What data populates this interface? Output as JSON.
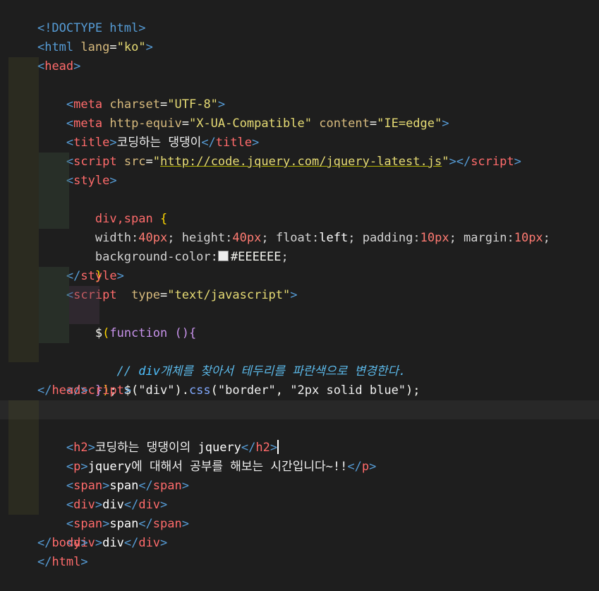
{
  "editor": {
    "lines": {
      "l1": "<!DOCTYPE html>",
      "l2_tag": "html",
      "l2_attr": "lang",
      "l2_val": "\"ko\"",
      "l3_tag": "head",
      "l4_tag": "meta",
      "l4_attr": "charset",
      "l4_val": "\"UTF-8\"",
      "l5_tag": "meta",
      "l5_attr1": "http-equiv",
      "l5_val1": "\"X-UA-Compatible\"",
      "l5_attr2": "content",
      "l5_val2": "\"IE=edge\"",
      "l6_tag": "title",
      "l6_text": "코딩하는 댕댕이",
      "l7_tag": "script",
      "l7_attr": "src",
      "l7_url": "http://code.jquery.com/jquery-latest.js",
      "l8_tag": "style",
      "l9_sel": "div,span",
      "l10_width": "width",
      "l10_width_v": "40px",
      "l10_height": "height",
      "l10_height_v": "40px",
      "l10_float": "float",
      "l10_float_v": "left",
      "l10_padding": "padding",
      "l10_padding_v": "10px",
      "l10_margin": "margin",
      "l10_margin_v": "10px",
      "l11_prop": "background-color",
      "l11_val": "#EEEEEE",
      "l13_tag": "style",
      "l14_tag": "script",
      "l14_attr": "type",
      "l14_val": "\"text/javascript\"",
      "l15_fn": "function",
      "l16_comment_kw": "div",
      "l16_comment": "개체를 찾아서 테두리를 파란색으로 변경한다.",
      "l17_sel": "\"div\"",
      "l17_method": "css",
      "l17_arg1": "\"border\"",
      "l17_arg2": "\"2px solid blue\"",
      "l19_tag": "script",
      "l20_tag": "head",
      "l21_tag": "body",
      "l22_tag": "h2",
      "l22_text": "코딩하는 댕댕이의 ",
      "l22_bold": "jquery",
      "l23_tag": "p",
      "l23_bold": "jquery",
      "l23_text": "에 대해서 공부를 해보는 시간입니다~!!",
      "l24_tag": "span",
      "l24_text": "span",
      "l25_tag": "div",
      "l25_text": "div",
      "l26_tag": "span",
      "l26_text": "span",
      "l27_tag": "div",
      "l27_text": "div",
      "l28_tag": "body",
      "l29_tag": "html"
    }
  },
  "colors": {
    "background": "#1e1e1e",
    "tag": "#569cd6",
    "attribute": "#d7ba7d",
    "string": "#ce9178",
    "swatch": "#EEEEEE"
  }
}
